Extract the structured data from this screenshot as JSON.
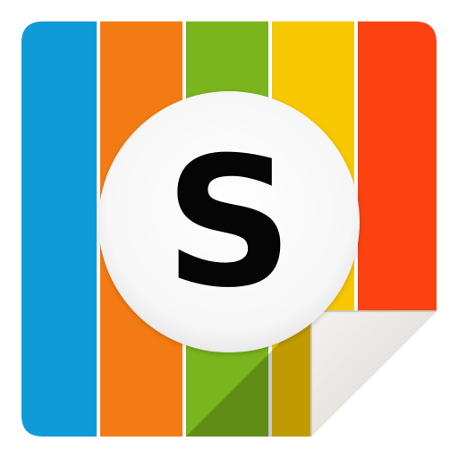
{
  "icon": {
    "letter": "S",
    "stripes": [
      {
        "name": "blue",
        "color": "#0f9ad8"
      },
      {
        "name": "orange",
        "color": "#f47b14"
      },
      {
        "name": "green",
        "color": "#7ab51d"
      },
      {
        "name": "yellow",
        "color": "#f7c701"
      },
      {
        "name": "red",
        "color": "#fb4210"
      }
    ],
    "circle_color": "#ffffff",
    "letter_color": "#050505",
    "curl_color": "#e7e3df"
  }
}
